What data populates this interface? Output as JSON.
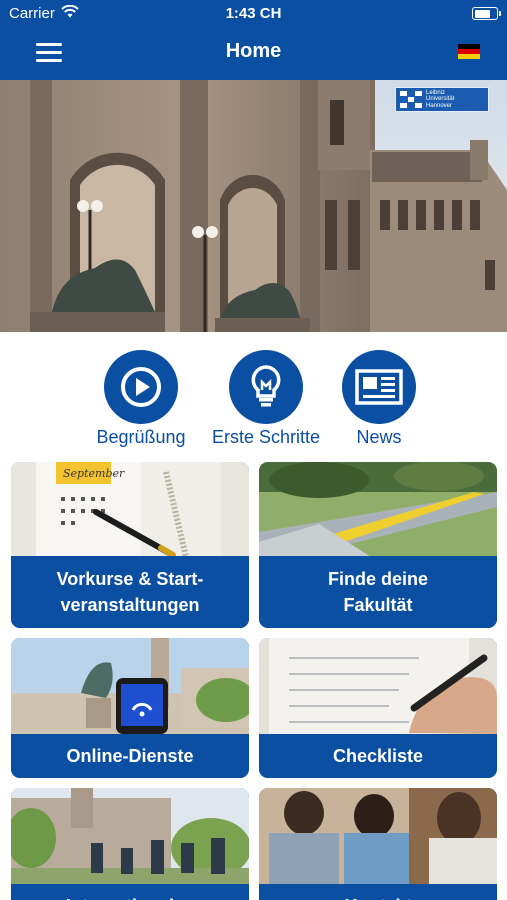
{
  "status": {
    "carrier": "Carrier",
    "time": "1:43 CH",
    "battery_level": 0.75
  },
  "nav": {
    "title": "Home",
    "menu_icon": "hamburger-menu-icon",
    "language_flag": "german-flag-icon"
  },
  "hero": {
    "logo_lines": [
      "Leibniz",
      "Universität",
      "Hannover"
    ]
  },
  "quick_links": [
    {
      "label": "Begrüßung",
      "icon": "play-icon"
    },
    {
      "label": "Erste Schritte",
      "icon": "lightbulb-icon"
    },
    {
      "label": "News",
      "icon": "newspaper-icon"
    }
  ],
  "tiles": [
    {
      "label": "Vorkurse & Start-veranstaltungen",
      "line1": "Vorkurse & Start-",
      "line2": "veranstaltungen",
      "image_caption": "September"
    },
    {
      "label": "Finde deine Fakultät",
      "line1": "Finde deine",
      "line2": "Fakultät"
    },
    {
      "label": "Online-Dienste"
    },
    {
      "label": "Checkliste"
    },
    {
      "label": "Internationales"
    },
    {
      "label": "Kontakt"
    }
  ],
  "colors": {
    "primary": "#0b4fa3",
    "background": "#ffffff"
  }
}
